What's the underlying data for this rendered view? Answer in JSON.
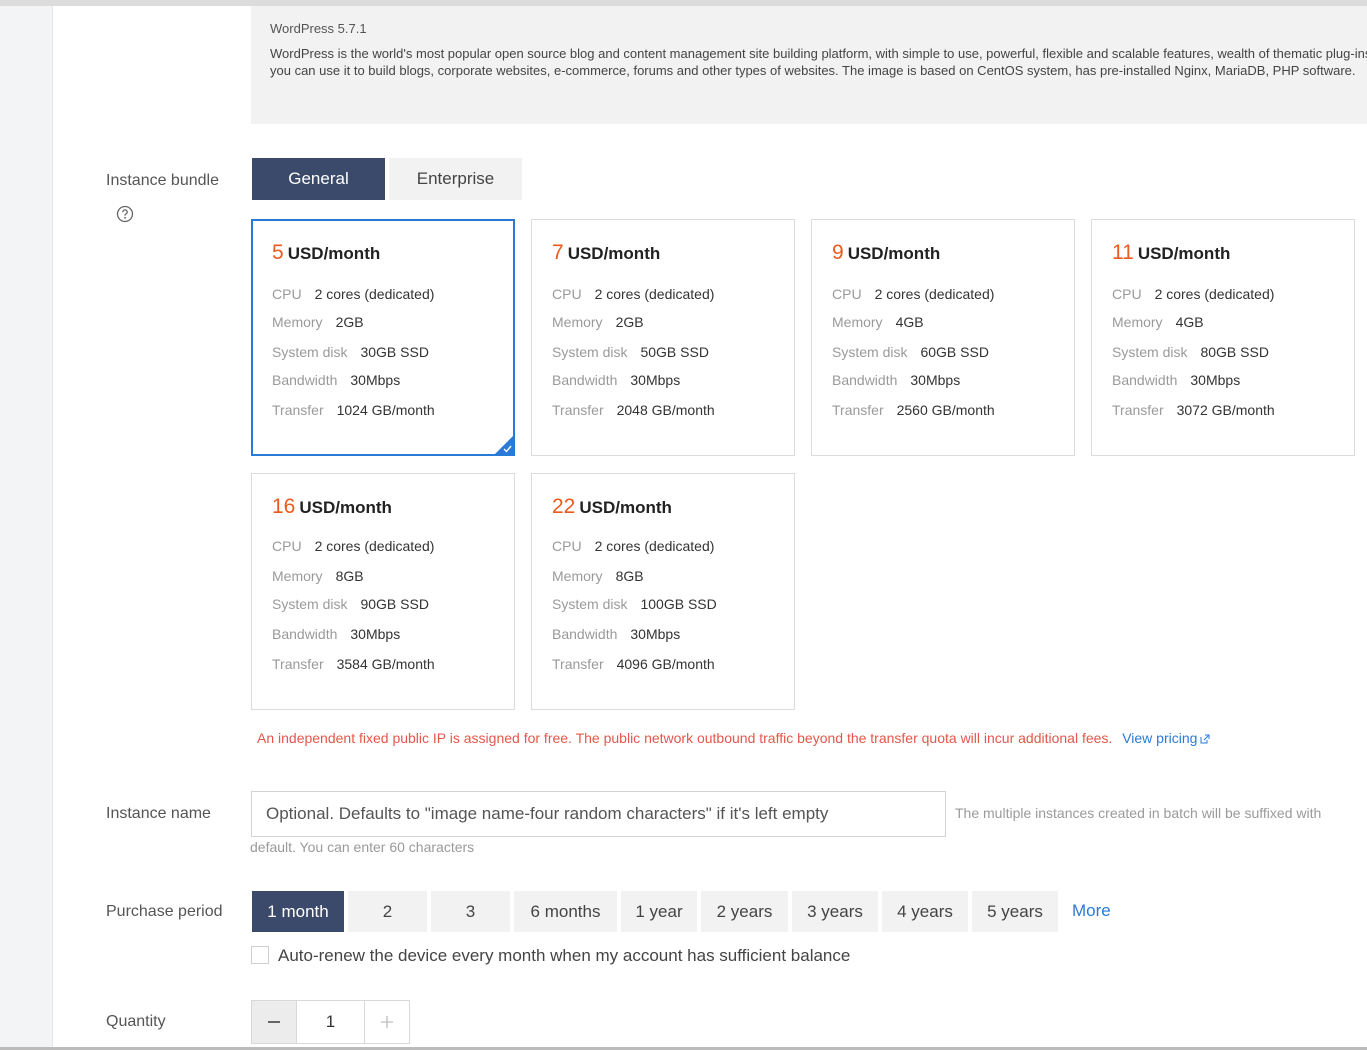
{
  "image": {
    "title": "WordPress 5.7.1",
    "description": "WordPress is the world's most popular open source blog and content management site building platform, with simple to use, powerful, flexible and scalable features, wealth of thematic plug-ins, you can use it to build blogs, corporate websites, e-commerce, forums and other types of websites. The image is based on CentOS system, has pre-installed Nginx, MariaDB, PHP software."
  },
  "bundle": {
    "label": "Instance bundle",
    "help_icon": "question-circle-icon",
    "tabs": [
      {
        "label": "General",
        "active": true
      },
      {
        "label": "Enterprise",
        "active": false
      }
    ],
    "spec_keys": {
      "cpu": "CPU",
      "memory": "Memory",
      "disk": "System disk",
      "bandwidth": "Bandwidth",
      "transfer": "Transfer"
    },
    "cards": [
      {
        "price": "5",
        "unit": "USD/month",
        "cpu": "2 cores (dedicated)",
        "memory": "2GB",
        "disk": "30GB SSD",
        "bandwidth": "30Mbps",
        "transfer": "1024 GB/month",
        "selected": true
      },
      {
        "price": "7",
        "unit": "USD/month",
        "cpu": "2 cores (dedicated)",
        "memory": "2GB",
        "disk": "50GB SSD",
        "bandwidth": "30Mbps",
        "transfer": "2048 GB/month",
        "selected": false
      },
      {
        "price": "9",
        "unit": "USD/month",
        "cpu": "2 cores (dedicated)",
        "memory": "4GB",
        "disk": "60GB SSD",
        "bandwidth": "30Mbps",
        "transfer": "2560 GB/month",
        "selected": false
      },
      {
        "price": "11",
        "unit": "USD/month",
        "cpu": "2 cores (dedicated)",
        "memory": "4GB",
        "disk": "80GB SSD",
        "bandwidth": "30Mbps",
        "transfer": "3072 GB/month",
        "selected": false
      },
      {
        "price": "16",
        "unit": "USD/month",
        "cpu": "2 cores (dedicated)",
        "memory": "8GB",
        "disk": "90GB SSD",
        "bandwidth": "30Mbps",
        "transfer": "3584 GB/month",
        "selected": false
      },
      {
        "price": "22",
        "unit": "USD/month",
        "cpu": "2 cores (dedicated)",
        "memory": "8GB",
        "disk": "100GB SSD",
        "bandwidth": "30Mbps",
        "transfer": "4096 GB/month",
        "selected": false
      }
    ],
    "notice": "An independent fixed public IP is assigned for free. The public network outbound traffic beyond the transfer quota will incur additional fees.",
    "pricing_link": "View pricing",
    "pricing_icon": "external-link-icon"
  },
  "instance_name": {
    "label": "Instance name",
    "placeholder": "Optional. Defaults to \"image name-four random characters\" if it's left empty",
    "hint": "The multiple instances created in batch will be suffixed with",
    "hint2": "default. You can enter 60 characters"
  },
  "purchase_period": {
    "label": "Purchase period",
    "options": [
      "1 month",
      "2",
      "3",
      "6 months",
      "1 year",
      "2 years",
      "3 years",
      "4 years",
      "5 years"
    ],
    "selected": "1 month",
    "more": "More",
    "auto_renew_label": "Auto-renew the device every month when my account has sufficient balance",
    "auto_renew_checked": false
  },
  "quantity": {
    "label": "Quantity",
    "value": "1",
    "minus_icon": "minus-icon",
    "plus_icon": "plus-icon"
  },
  "colors": {
    "accent": "#2a7ad8",
    "active_tab": "#3b4a6b",
    "price": "#ea5a1e",
    "warning": "#e4574a"
  }
}
